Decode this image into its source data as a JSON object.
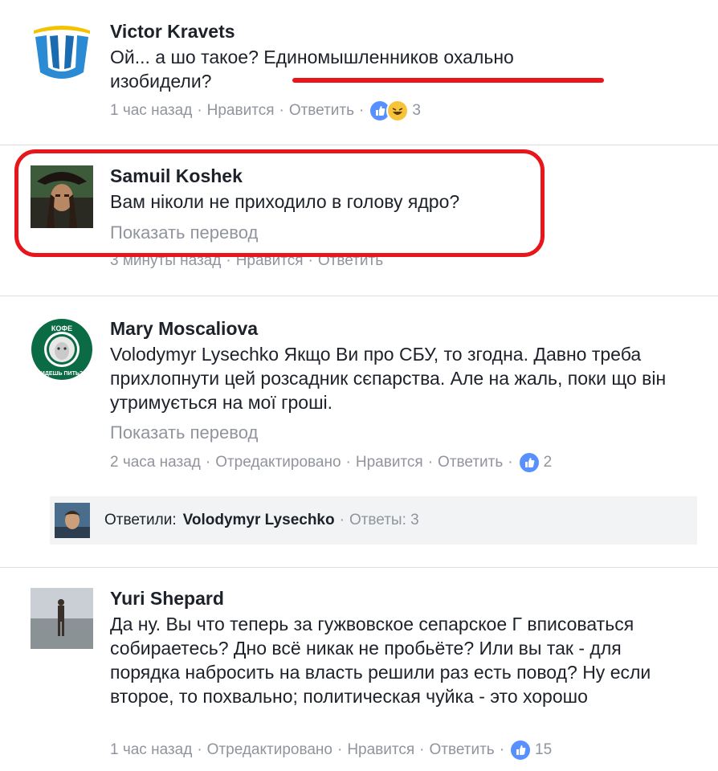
{
  "comments": [
    {
      "author": "Victor Kravets",
      "text": "Ой... а шо такое? Единомышленников охально изобидели?",
      "time": "1 час назад",
      "like": "Нравится",
      "reply": "Ответить",
      "reaction_count": "3"
    },
    {
      "author": "Samuil Koshek",
      "text": "Вам ніколи не приходило в голову ядро?",
      "translate": "Показать перевод",
      "time": "3 минуты назад",
      "like": "Нравится",
      "reply": "Ответить"
    },
    {
      "author": "Mary Moscaliova",
      "text": "Volodymyr Lysechko Якщо Ви про СБУ, то згодна. Давно треба прихлопнути цей розсадник сєпарства. Але на жаль, поки що він утримується на мої гроші.",
      "translate": "Показать перевод",
      "time": "2 часа назад",
      "edited": "Отредактировано",
      "like": "Нравится",
      "reply": "Ответить",
      "reaction_count": "2",
      "replies": {
        "label": "Ответили:",
        "name": "Volodymyr Lysechko",
        "count": "Ответы: 3"
      }
    },
    {
      "author": "Yuri Shepard",
      "text": "Да ну. Вы что теперь за гужвовское сепарское Г вписоваться собираетесь? Дно всё никак не пробьёте? Или вы так - для порядка набросить на власть решили раз есть повод? Ну если второе, то похвально; политическая чуйка - это хорошо",
      "time": "1 час назад",
      "edited": "Отредактировано",
      "like": "Нравится",
      "reply": "Ответить",
      "reaction_count": "15"
    }
  ],
  "avatar_texts": {
    "coffee_top": "КОФЕ",
    "coffee_bottom": "ИДЕШЬ ПИТЬ?"
  },
  "colors": {
    "highlight_red": "#e8151b",
    "like_blue": "#5890ff",
    "meta_gray": "#90949c"
  }
}
